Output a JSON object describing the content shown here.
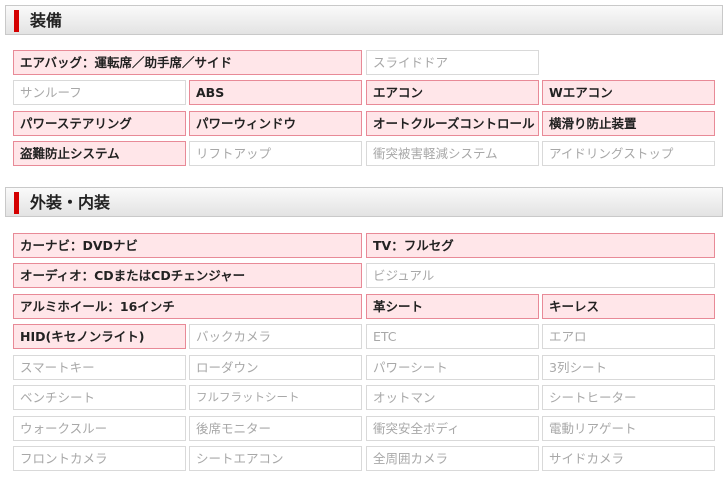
{
  "sections": [
    {
      "title": "装備",
      "items": [
        {
          "label": "エアバッグ：運転席／助手席／サイド",
          "active": true
        },
        {
          "label": "スライドドア",
          "active": false
        },
        {
          "label": "サンルーフ",
          "active": false
        },
        {
          "label": "ABS",
          "active": true
        },
        {
          "label": "エアコン",
          "active": true
        },
        {
          "label": "Wエアコン",
          "active": true
        },
        {
          "label": "パワーステアリング",
          "active": true
        },
        {
          "label": "パワーウィンドウ",
          "active": true
        },
        {
          "label": "オートクルーズコントロール",
          "active": true
        },
        {
          "label": "横滑り防止装置",
          "active": true
        },
        {
          "label": "盗難防止システム",
          "active": true
        },
        {
          "label": "リフトアップ",
          "active": false
        },
        {
          "label": "衝突被害軽減システム",
          "active": false
        },
        {
          "label": "アイドリングストップ",
          "active": false
        }
      ]
    },
    {
      "title": "外装・内装",
      "items": [
        {
          "label": "カーナビ：DVDナビ",
          "active": true
        },
        {
          "label": "TV：フルセグ",
          "active": true
        },
        {
          "label": "オーディオ：CDまたはCDチェンジャー",
          "active": true
        },
        {
          "label": "ビジュアル",
          "active": false
        },
        {
          "label": "アルミホイール：16インチ",
          "active": true
        },
        {
          "label": "革シート",
          "active": true
        },
        {
          "label": "キーレス",
          "active": true
        },
        {
          "label": "HID(キセノンライト)",
          "active": true
        },
        {
          "label": "バックカメラ",
          "active": false
        },
        {
          "label": "ETC",
          "active": false
        },
        {
          "label": "エアロ",
          "active": false
        },
        {
          "label": "スマートキー",
          "active": false
        },
        {
          "label": "ローダウン",
          "active": false
        },
        {
          "label": "パワーシート",
          "active": false
        },
        {
          "label": "3列シート",
          "active": false
        },
        {
          "label": "ベンチシート",
          "active": false
        },
        {
          "label": "フルフラットシート",
          "active": false
        },
        {
          "label": "オットマン",
          "active": false
        },
        {
          "label": "シートヒーター",
          "active": false
        },
        {
          "label": "ウォークスルー",
          "active": false
        },
        {
          "label": "後席モニター",
          "active": false
        },
        {
          "label": "衝突安全ボディ",
          "active": false
        },
        {
          "label": "電動リアゲート",
          "active": false
        },
        {
          "label": "フロントカメラ",
          "active": false
        },
        {
          "label": "シートエアコン",
          "active": false
        },
        {
          "label": "全周囲カメラ",
          "active": false
        },
        {
          "label": "サイドカメラ",
          "active": false
        }
      ]
    }
  ]
}
